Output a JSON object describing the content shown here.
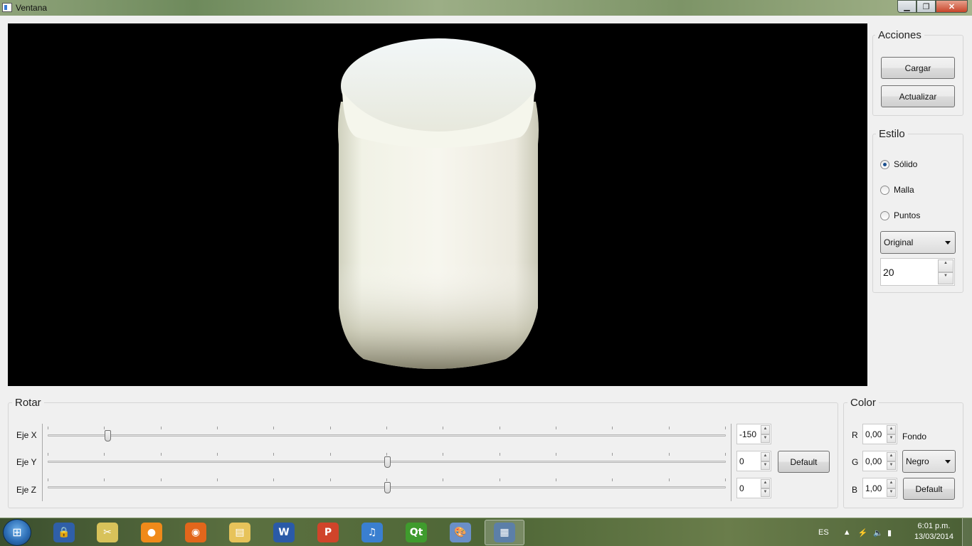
{
  "window": {
    "title": "Ventana",
    "minimize_label": "▁",
    "maximize_label": "❐",
    "close_label": "✕"
  },
  "acciones": {
    "title": "Acciones",
    "cargar": "Cargar",
    "actualizar": "Actualizar"
  },
  "estilo": {
    "title": "Estilo",
    "options": [
      "Sólido",
      "Malla",
      "Puntos"
    ],
    "selected": "Sólido",
    "combo_value": "Original",
    "spin_value": "20"
  },
  "rotar": {
    "title": "Rotar",
    "axes": [
      {
        "label": "Eje X",
        "value": "-150",
        "slider_fraction": 0.088
      },
      {
        "label": "Eje Y",
        "value": "0",
        "slider_fraction": 0.5
      },
      {
        "label": "Eje Z",
        "value": "0",
        "slider_fraction": 0.5
      }
    ],
    "default_label": "Default"
  },
  "color": {
    "title": "Color",
    "r_label": "R",
    "r_value": "0,00",
    "g_label": "G",
    "g_value": "0,00",
    "b_label": "B",
    "b_value": "1,00",
    "fondo_label": "Fondo",
    "fondo_value": "Negro",
    "default_label": "Default"
  },
  "taskbar": {
    "start_glyph": "⊞",
    "apps": [
      {
        "name": "keepass-icon",
        "glyph": "🔒",
        "color": "#2f5fa8"
      },
      {
        "name": "snipping-tool-icon",
        "glyph": "✂",
        "color": "#d8c25a"
      },
      {
        "name": "orange-app-icon",
        "glyph": "●",
        "color": "#f08a1a"
      },
      {
        "name": "firefox-icon",
        "glyph": "◉",
        "color": "#e2661b"
      },
      {
        "name": "explorer-icon",
        "glyph": "▤",
        "color": "#e7c35a"
      },
      {
        "name": "word-icon",
        "glyph": "W",
        "color": "#2a5aa8"
      },
      {
        "name": "powerpoint-icon",
        "glyph": "P",
        "color": "#d0442a"
      },
      {
        "name": "itunes-icon",
        "glyph": "♫",
        "color": "#3a7fd0"
      },
      {
        "name": "qt-creator-icon",
        "glyph": "Qt",
        "color": "#3f9b2d"
      },
      {
        "name": "paint-icon",
        "glyph": "🎨",
        "color": "#6a8fc8"
      },
      {
        "name": "ventana-app-icon",
        "glyph": "▦",
        "color": "#5c7fa8"
      }
    ],
    "language": "ES",
    "time": "6:01 p.m.",
    "date": "13/03/2014"
  }
}
